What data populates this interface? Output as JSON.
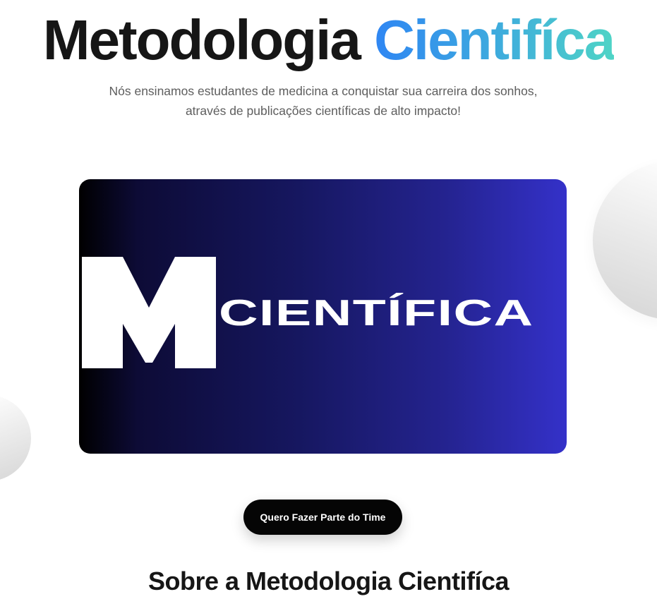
{
  "hero": {
    "title_main": "Metodologia",
    "title_accent": "Cientifíca",
    "subtitle_line1": "Nós ensinamos estudantes de medicina a conquistar sua carreira dos sonhos,",
    "subtitle_line2": "através de publicações científicas de alto impacto!"
  },
  "banner": {
    "logo_letter": "M",
    "logo_word": "CIENTÍFICA"
  },
  "cta": {
    "label": "Quero Fazer Parte do Time"
  },
  "about": {
    "title": "Sobre a Metodologia Cientifíca"
  },
  "colors": {
    "accent_gradient_start": "#2f86f3",
    "accent_gradient_end": "#4fd4c6",
    "banner_gradient_start": "#000000",
    "banner_gradient_end": "#3431c9",
    "button_bg": "#050505",
    "text_dark": "#161616",
    "text_muted": "#5e5e5e"
  }
}
